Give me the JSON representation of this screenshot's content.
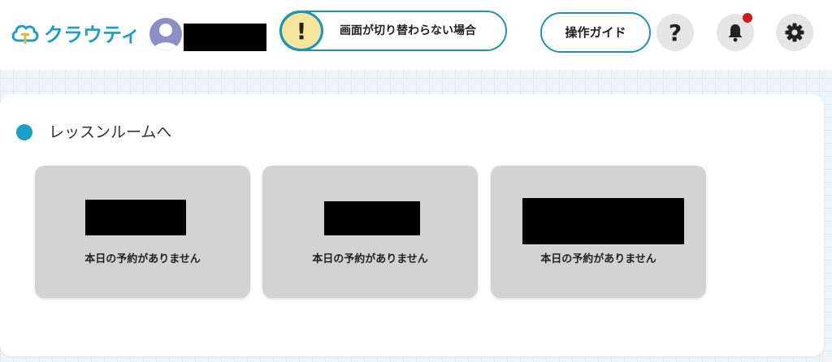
{
  "header": {
    "logo_text": "クラウティ",
    "alert_mark": "!",
    "alert_text": "画面が切り替わらない場合",
    "guide_label": "操作ガイド",
    "help_label": "?"
  },
  "section": {
    "title": "レッスンルームへ"
  },
  "rooms": [
    {
      "status": "本日の予約がありません"
    },
    {
      "status": "本日の予約がありません"
    },
    {
      "status": "本日の予約がありません"
    }
  ],
  "colors": {
    "accent": "#1aa0c8",
    "alert_fill": "#f6e59a",
    "notification": "#d11a1a",
    "room_card": "#d3d3d3"
  }
}
